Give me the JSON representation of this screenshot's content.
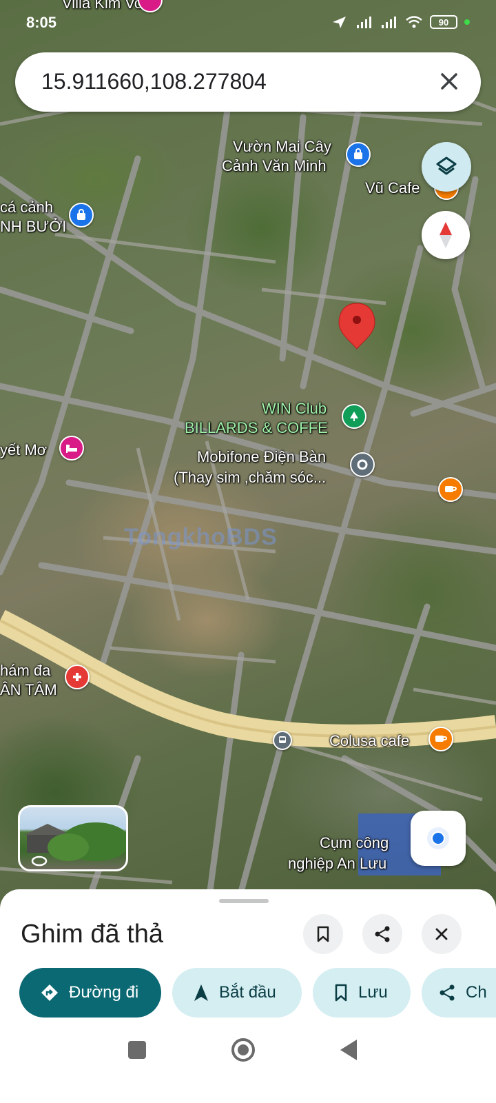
{
  "status_bar": {
    "time": "8:05",
    "battery": "90"
  },
  "search": {
    "query": "15.911660,108.277804"
  },
  "map": {
    "labels": {
      "top_partial": "Villa Kim Vo",
      "vuon_mai_1": "Vườn Mai Cây",
      "vuon_mai_2": "Cảnh Văn Minh",
      "vu_cafe": "Vũ Cafe",
      "ca_canh_1": "cá cảnh",
      "ca_canh_2": "NH BƯỞI",
      "win_club_1": "WIN Club",
      "win_club_2": "BILLARDS & COFFE",
      "yet_mo": "yết Mơ",
      "mobifone_1": "Mobifone Điện Bàn",
      "mobifone_2": "(Thay sim ,chăm sóc...",
      "cham_da_1": "hám đa",
      "cham_da_2": "ÂN TÂM",
      "colusa": "Colusa cafe",
      "cum_cn_1": "Cụm công",
      "cum_cn_2": "nghiệp An Lưu"
    },
    "watermark": "TongkhoBDS"
  },
  "sheet": {
    "title": "Ghim đã thả",
    "chips": {
      "directions": "Đường đi",
      "start": "Bắt đầu",
      "save": "Lưu",
      "share": "Ch"
    }
  },
  "colors": {
    "primary_teal": "#0b6973",
    "chip_light": "#d4eef2",
    "pin_red": "#e53935",
    "poi_blue": "#1a73e8",
    "poi_green": "#0f9d58",
    "poi_orange": "#f57c00",
    "poi_pink": "#d81b86"
  }
}
